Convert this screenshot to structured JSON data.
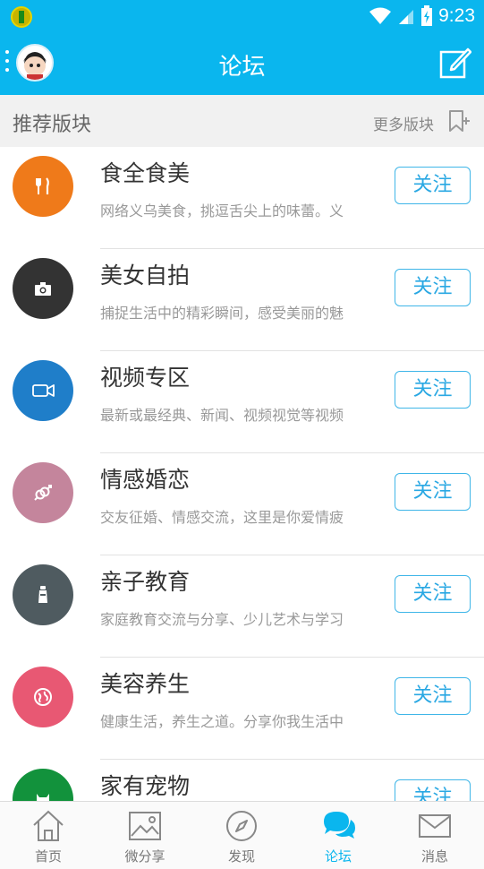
{
  "status_bar": {
    "time": "9:23"
  },
  "header": {
    "title": "论坛"
  },
  "section": {
    "title": "推荐版块",
    "more_label": "更多版块"
  },
  "forums": [
    {
      "name": "食全食美",
      "desc": "网络义乌美食，挑逗舌尖上的味蕾。义",
      "icon": "fork-knife-icon",
      "color": "#ef7a1a",
      "follow_label": "关注"
    },
    {
      "name": "美女自拍",
      "desc": "捕捉生活中的精彩瞬间，感受美丽的魅",
      "icon": "camera-icon",
      "color": "#333333",
      "follow_label": "关注"
    },
    {
      "name": "视频专区",
      "desc": "最新或最经典、新闻、视频视觉等视频",
      "icon": "video-camera-icon",
      "color": "#1f7ec9",
      "follow_label": "关注"
    },
    {
      "name": "情感婚恋",
      "desc": "交友征婚、情感交流，这里是你爱情疲",
      "icon": "gender-rings-icon",
      "color": "#c4859c",
      "follow_label": "关注"
    },
    {
      "name": "亲子教育",
      "desc": "家庭教育交流与分享、少儿艺术与学习",
      "icon": "bottle-icon",
      "color": "#4f5b60",
      "follow_label": "关注"
    },
    {
      "name": "美容养生",
      "desc": "健康生活，养生之道。分享你我生活中",
      "icon": "globe-icon",
      "color": "#e85873",
      "follow_label": "关注"
    },
    {
      "name": "家有宠物",
      "desc": "",
      "icon": "cat-icon",
      "color": "#12923c",
      "follow_label": "关注"
    }
  ],
  "tabs": [
    {
      "label": "首页",
      "icon": "home-icon"
    },
    {
      "label": "微分享",
      "icon": "image-icon"
    },
    {
      "label": "发现",
      "icon": "compass-icon"
    },
    {
      "label": "论坛",
      "icon": "chat-bubbles-icon"
    },
    {
      "label": "消息",
      "icon": "envelope-icon"
    }
  ],
  "colors": {
    "accent": "#0ab6ee",
    "active_tab": "#0ab6ee"
  }
}
